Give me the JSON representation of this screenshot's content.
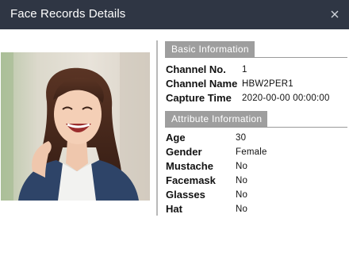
{
  "dialog": {
    "title": "Face Records Details",
    "close_icon": "close-icon"
  },
  "photo": {
    "description_icon": "face-capture-photo"
  },
  "basic": {
    "header": "Basic Information",
    "channel_no": {
      "label": "Channel No.",
      "value": "1"
    },
    "channel_name": {
      "label": "Channel Name",
      "value": "HBW2PER1"
    },
    "capture_time": {
      "label": "Capture Time",
      "value": "2020-00-00 00:00:00"
    }
  },
  "attributes": {
    "header": "Attribute Information",
    "age": {
      "label": "Age",
      "value": "30"
    },
    "gender": {
      "label": "Gender",
      "value": "Female"
    },
    "mustache": {
      "label": "Mustache",
      "value": "No"
    },
    "facemask": {
      "label": "Facemask",
      "value": "No"
    },
    "glasses": {
      "label": "Glasses",
      "value": "No"
    },
    "hat": {
      "label": "Hat",
      "value": "No"
    }
  },
  "colors": {
    "titlebar": "#2f3644",
    "section_tab": "#9e9e9e",
    "divider": "#b9b9b9"
  }
}
